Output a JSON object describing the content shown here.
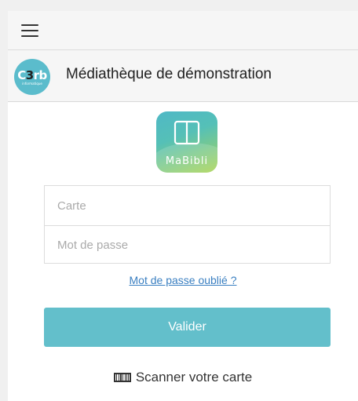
{
  "header": {
    "menu_icon": "hamburger-menu-icon"
  },
  "library": {
    "logo_text_main_left": "C",
    "logo_text_main_mid": "3",
    "logo_text_main_right": "rb",
    "logo_text_sub": "informatique",
    "name": "Médiathèque de démonstration"
  },
  "app": {
    "name": "MaBibli",
    "icon": "open-book-icon"
  },
  "login": {
    "card_placeholder": "Carte",
    "password_placeholder": "Mot de passe",
    "card_value": "",
    "password_value": "",
    "forgot_password": "Mot de passe oublié ?",
    "submit_label": "Valider",
    "scan_label": "Scanner votre carte",
    "scan_icon": "barcode-icon"
  },
  "colors": {
    "accent": "#63bfcb",
    "link": "#3a7fc1",
    "logo_circle": "#5bbccc"
  }
}
